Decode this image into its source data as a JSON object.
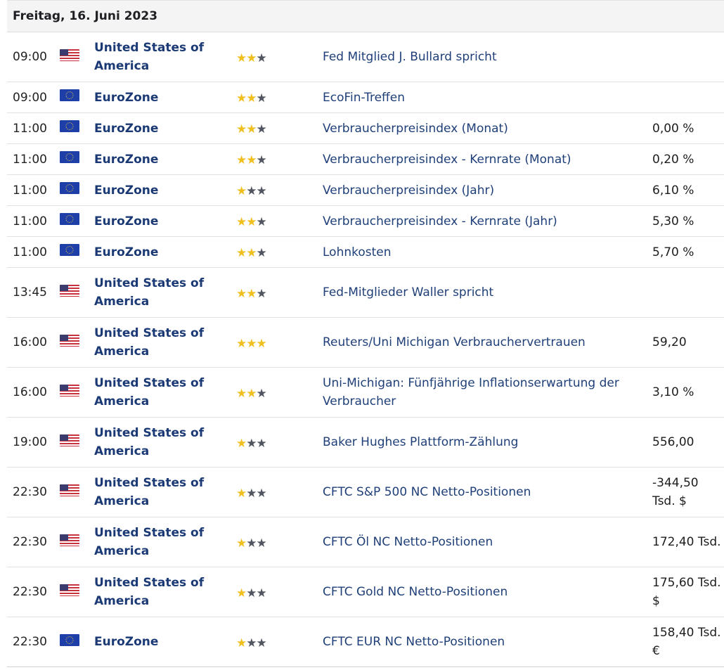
{
  "header": {
    "date": "Freitag, 16. Juni 2023"
  },
  "colors": {
    "star_on": "#f0c020",
    "star_off": "#505560",
    "link": "#1f3f78"
  },
  "rows": [
    {
      "time": "09:00",
      "flag": "us-flag-icon",
      "country": "United States of America",
      "stars": 2,
      "event": "Fed Mitglied J. Bullard spricht",
      "value": ""
    },
    {
      "time": "09:00",
      "flag": "eu-flag-icon",
      "country": "EuroZone",
      "stars": 2,
      "event": "EcoFin-Treffen",
      "value": ""
    },
    {
      "time": "11:00",
      "flag": "eu-flag-icon",
      "country": "EuroZone",
      "stars": 2,
      "event": "Verbraucherpreisindex (Monat)",
      "value": "0,00 %"
    },
    {
      "time": "11:00",
      "flag": "eu-flag-icon",
      "country": "EuroZone",
      "stars": 2,
      "event": "Verbraucherpreisindex - Kernrate (Monat)",
      "value": "0,20 %"
    },
    {
      "time": "11:00",
      "flag": "eu-flag-icon",
      "country": "EuroZone",
      "stars": 1,
      "event": "Verbraucherpreisindex (Jahr)",
      "value": "6,10 %"
    },
    {
      "time": "11:00",
      "flag": "eu-flag-icon",
      "country": "EuroZone",
      "stars": 2,
      "event": "Verbraucherpreisindex - Kernrate (Jahr)",
      "value": "5,30 %"
    },
    {
      "time": "11:00",
      "flag": "eu-flag-icon",
      "country": "EuroZone",
      "stars": 2,
      "event": "Lohnkosten",
      "value": "5,70 %"
    },
    {
      "time": "13:45",
      "flag": "us-flag-icon",
      "country": "United States of America",
      "stars": 2,
      "event": "Fed-Mitglieder Waller spricht",
      "value": ""
    },
    {
      "time": "16:00",
      "flag": "us-flag-icon",
      "country": "United States of America",
      "stars": 3,
      "event": "Reuters/Uni Michigan Verbrauchervertrauen",
      "value": "59,20"
    },
    {
      "time": "16:00",
      "flag": "us-flag-icon",
      "country": "United States of America",
      "stars": 2,
      "event": "Uni-Michigan: Fünfjährige Inflationserwartung der Verbraucher",
      "value": "3,10 %"
    },
    {
      "time": "19:00",
      "flag": "us-flag-icon",
      "country": "United States of America",
      "stars": 1,
      "event": "Baker Hughes Plattform-Zählung",
      "value": "556,00"
    },
    {
      "time": "22:30",
      "flag": "us-flag-icon",
      "country": "United States of America",
      "stars": 1,
      "event": "CFTC S&P 500 NC Netto-Positionen",
      "value": "-344,50 Tsd. $"
    },
    {
      "time": "22:30",
      "flag": "us-flag-icon",
      "country": "United States of America",
      "stars": 1,
      "event": "CFTC Öl NC Netto-Positionen",
      "value": "172,40 Tsd."
    },
    {
      "time": "22:30",
      "flag": "us-flag-icon",
      "country": "United States of America",
      "stars": 1,
      "event": "CFTC Gold NC Netto-Positionen",
      "value": "175,60 Tsd. $"
    },
    {
      "time": "22:30",
      "flag": "eu-flag-icon",
      "country": "EuroZone",
      "stars": 1,
      "event": "CFTC EUR NC Netto-Positionen",
      "value": "158,40 Tsd. €"
    }
  ]
}
